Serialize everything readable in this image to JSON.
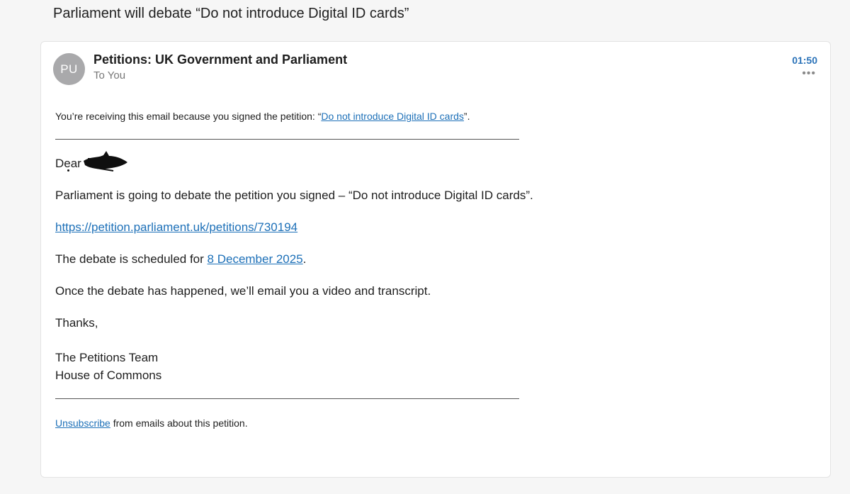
{
  "subject": "Parliament will debate “Do not introduce Digital ID cards”",
  "header": {
    "avatar_initials": "PU",
    "sender": "Petitions: UK Government and Parliament",
    "recipient": "To You",
    "time": "01:50",
    "more_glyph": "•••"
  },
  "body": {
    "notice_prefix": "You’re receiving this email because you signed the petition: “",
    "notice_link": "Do not introduce Digital ID cards",
    "notice_suffix": "”.",
    "greeting": "Dear",
    "paragraph_debate": "Parliament is going to debate the petition you signed – “Do not introduce Digital ID cards”.",
    "petition_url": "https://petition.parliament.uk/petitions/730194",
    "scheduled_prefix": "The debate is scheduled for ",
    "scheduled_date": "8 December 2025",
    "scheduled_suffix": ".",
    "followup": "Once the debate has happened, we’ll email you a video and transcript.",
    "thanks": "Thanks,",
    "signature_team": "The Petitions Team",
    "signature_house": "House of Commons"
  },
  "footer": {
    "unsubscribe_link": "Unsubscribe",
    "unsubscribe_suffix": " from emails about this petition."
  },
  "colors": {
    "link": "#1d70b8",
    "time": "#2a72b8",
    "avatar": "#a9a9ab"
  }
}
